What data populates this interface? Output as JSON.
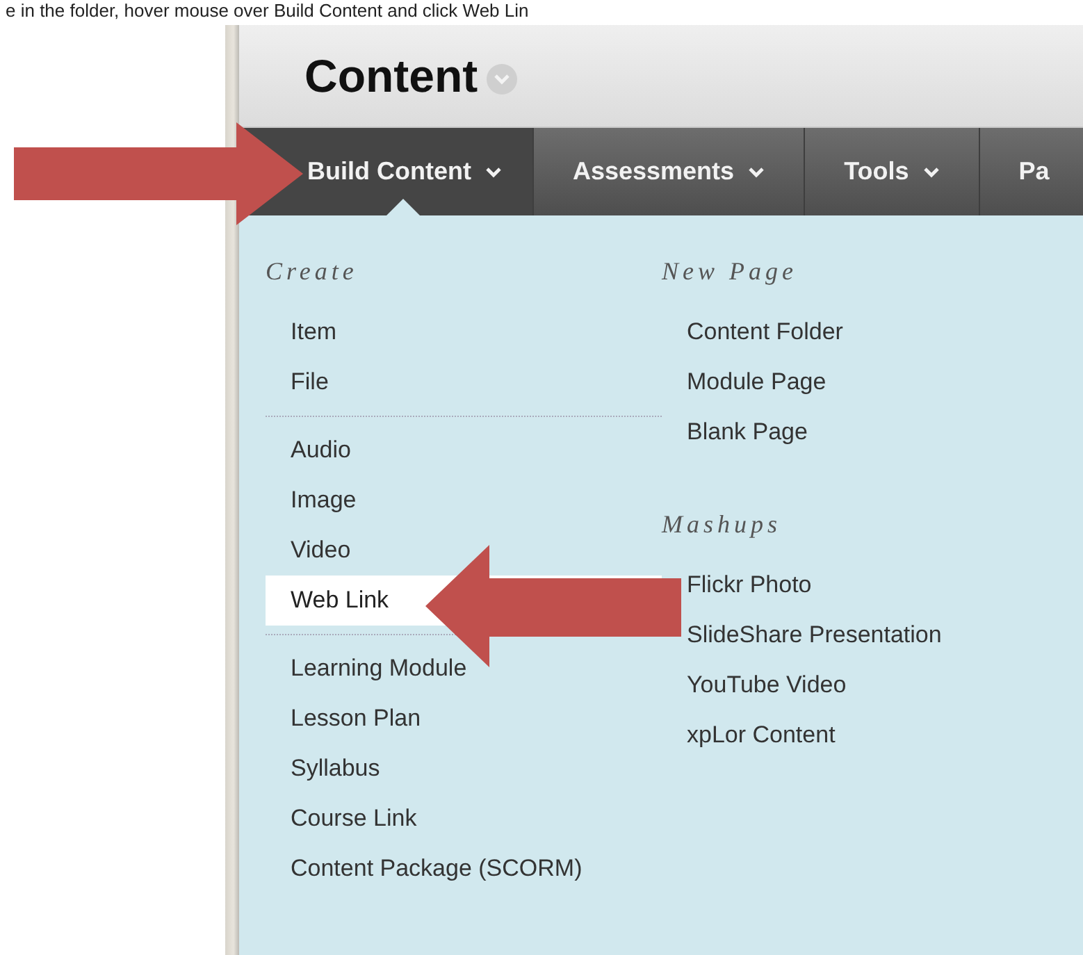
{
  "caption": "e in the folder, hover mouse over Build Content and click Web Lin",
  "page_title": "Content",
  "tabs": [
    {
      "label": "Build Content",
      "selected": true,
      "dropdown": true
    },
    {
      "label": "Assessments",
      "selected": false,
      "dropdown": true
    },
    {
      "label": "Tools",
      "selected": false,
      "dropdown": true
    },
    {
      "label": "Pa",
      "selected": false,
      "dropdown": false
    }
  ],
  "menu": {
    "columns": [
      {
        "sections": [
          {
            "heading": "Create",
            "groups": [
              {
                "items": [
                  {
                    "label": "Item",
                    "selected": false
                  },
                  {
                    "label": "File",
                    "selected": false
                  }
                ]
              },
              {
                "items": [
                  {
                    "label": "Audio",
                    "selected": false
                  },
                  {
                    "label": "Image",
                    "selected": false
                  },
                  {
                    "label": "Video",
                    "selected": false
                  },
                  {
                    "label": "Web Link",
                    "selected": true
                  }
                ]
              },
              {
                "items": [
                  {
                    "label": "Learning Module",
                    "selected": false
                  },
                  {
                    "label": "Lesson Plan",
                    "selected": false
                  },
                  {
                    "label": "Syllabus",
                    "selected": false
                  },
                  {
                    "label": "Course Link",
                    "selected": false
                  },
                  {
                    "label": "Content Package (SCORM)",
                    "selected": false
                  }
                ]
              }
            ]
          }
        ]
      },
      {
        "sections": [
          {
            "heading": "New Page",
            "groups": [
              {
                "items": [
                  {
                    "label": "Content Folder",
                    "selected": false
                  },
                  {
                    "label": "Module Page",
                    "selected": false
                  },
                  {
                    "label": "Blank Page",
                    "selected": false
                  }
                ]
              }
            ]
          },
          {
            "heading": "Mashups",
            "groups": [
              {
                "items": [
                  {
                    "label": "Flickr Photo",
                    "selected": false
                  },
                  {
                    "label": "SlideShare Presentation",
                    "selected": false
                  },
                  {
                    "label": "YouTube Video",
                    "selected": false
                  },
                  {
                    "label": "xpLor Content",
                    "selected": false
                  }
                ]
              }
            ]
          }
        ]
      }
    ]
  }
}
